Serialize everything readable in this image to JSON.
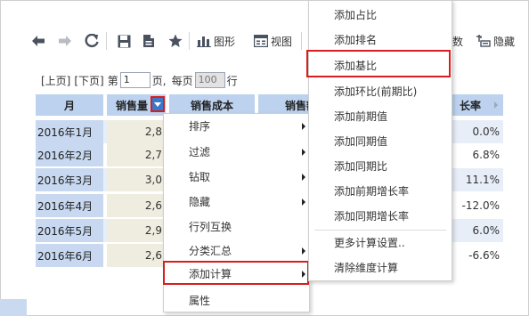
{
  "toolbar": {
    "chart_label": "图形",
    "view_label": "视图",
    "partial_label": "数",
    "hide_label": "隐藏"
  },
  "pager": {
    "prev": "[上页]",
    "next": "[下页]",
    "page_prefix": "第",
    "page_value": "1",
    "page_suffix": "页,",
    "per_page_prefix": "每页",
    "per_page_value": "100",
    "per_page_suffix": "行"
  },
  "table": {
    "headers": {
      "month": "月",
      "sales": "销售量",
      "cost": "销售成本",
      "amount": "销售额",
      "growth": "长率"
    },
    "rows": [
      {
        "month": "2016年1月",
        "sales": "2,8",
        "rate": "0.0%"
      },
      {
        "month": "2016年2月",
        "sales": "2,7",
        "rate": "6.8%"
      },
      {
        "month": "2016年3月",
        "sales": "3,0",
        "rate": "11.1%"
      },
      {
        "month": "2016年4月",
        "sales": "2,6",
        "rate": "-12.0%"
      },
      {
        "month": "2016年5月",
        "sales": "2,9",
        "rate": "6.0%"
      },
      {
        "month": "2016年6月",
        "sales": "2,6",
        "rate": "-6.6%"
      }
    ]
  },
  "context_menu": {
    "items": [
      "排序",
      "过滤",
      "钻取",
      "隐藏",
      "行列互换",
      "分类汇总",
      "添加计算",
      "属性"
    ]
  },
  "submenu": {
    "items": [
      "添加占比",
      "添加排名",
      "添加基比",
      "添加环比(前期比)",
      "添加前期值",
      "添加同期值",
      "添加同期比",
      "添加前期增长率",
      "添加同期增长率",
      "更多计算设置..",
      "清除维度计算"
    ]
  }
}
